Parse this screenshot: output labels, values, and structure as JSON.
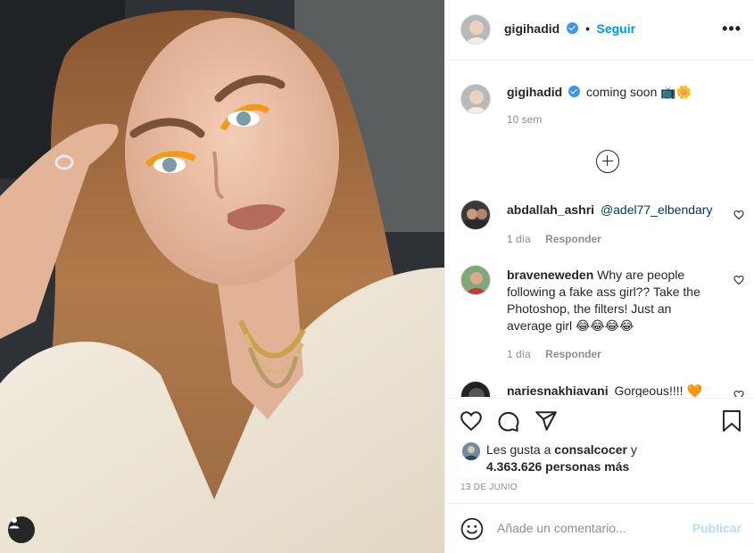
{
  "post": {
    "author": "gigihadid",
    "follow_label": "Seguir",
    "dot": "•",
    "more_label": "•••"
  },
  "caption": {
    "author": "gigihadid",
    "text": "coming soon",
    "emoji": "📺🌼",
    "time": "10 sem"
  },
  "comments": [
    {
      "author": "abdallah_ashri",
      "mention": "@adel77_elbendary",
      "text": "",
      "time": "1 día",
      "reply_label": "Responder"
    },
    {
      "author": "braveneweden",
      "text_line1": "Why are people",
      "text_line2": "following a fake ass girl?? Take the",
      "text_line3": "Photoshop, the filters! Just an",
      "text_line4": "average girl 😂😂😂😂",
      "time": "1 día",
      "reply_label": "Responder"
    },
    {
      "author": "nariesnakhiavani",
      "text": "Gorgeous!!!! 🧡"
    }
  ],
  "likes": {
    "prefix": "Les gusta a",
    "user": "consalcocer",
    "conj": "y",
    "count": "4.363.626 personas más"
  },
  "date": "13 DE JUNIO",
  "add_comment": {
    "placeholder": "Añade un comentario...",
    "publish_label": "Publicar"
  },
  "icons": [
    "user-tag-icon",
    "verified-badge-icon",
    "more-options-icon",
    "load-more-comments-icon",
    "heart-icon",
    "comment-icon",
    "share-icon",
    "bookmark-icon",
    "emoji-icon"
  ],
  "colors": {
    "accent": "#0095f6",
    "text": "#262626",
    "muted": "#8e8e8e",
    "border": "#efefef",
    "publish_disabled": "#b2dffc",
    "verified": "#3897f0"
  }
}
